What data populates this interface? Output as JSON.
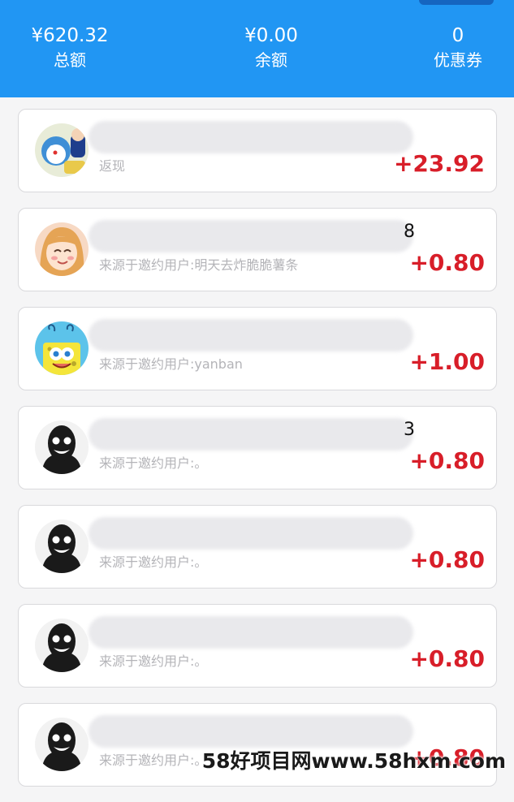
{
  "colors": {
    "header_bg": "#2196f3",
    "amount": "#d81e29",
    "sub_text": "#b4b4b8"
  },
  "summary": {
    "total": {
      "value": "¥620.32",
      "label": "总额"
    },
    "balance": {
      "value": "¥0.00",
      "label": "余额"
    },
    "coupons": {
      "value": "0",
      "label": "优惠券"
    }
  },
  "records": [
    {
      "avatar": "cartoon-cat-avatar",
      "title_tail": "",
      "subtitle": "返现",
      "amount": "+23.92"
    },
    {
      "avatar": "cartoon-girl-avatar",
      "title_tail": "8",
      "subtitle": "来源于邀约用户:明天去炸脆脆薯条",
      "amount": "+0.80"
    },
    {
      "avatar": "sponge-cartoon-avatar",
      "title_tail": "",
      "subtitle": "来源于邀约用户:yanban",
      "amount": "+1.00"
    },
    {
      "avatar": "dark-face-avatar",
      "title_tail": "3",
      "subtitle": "来源于邀约用户:。",
      "amount": "+0.80"
    },
    {
      "avatar": "dark-face-avatar",
      "title_tail": "",
      "subtitle": "来源于邀约用户:。",
      "amount": "+0.80"
    },
    {
      "avatar": "dark-face-avatar",
      "title_tail": "",
      "subtitle": "来源于邀约用户:。",
      "amount": "+0.80"
    },
    {
      "avatar": "dark-face-avatar",
      "title_tail": "",
      "subtitle": "来源于邀约用户:。",
      "amount": "+0.80"
    }
  ],
  "watermark": "58好项目网www.58hxm.com"
}
